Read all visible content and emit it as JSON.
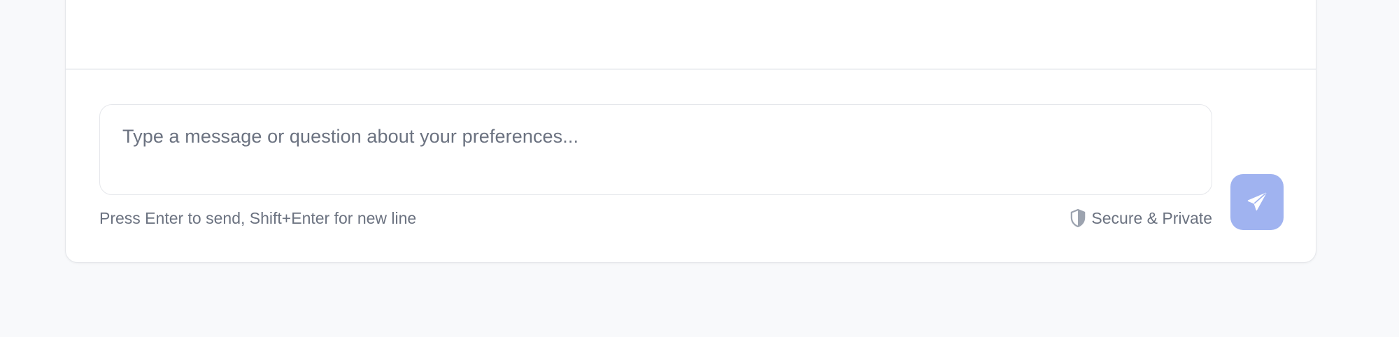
{
  "composer": {
    "placeholder": "Type a message or question about your preferences...",
    "value": "",
    "hint": "Press Enter to send, Shift+Enter for new line",
    "secure_label": "Secure & Private",
    "send_icon": "paper-plane-icon",
    "shield_icon": "shield-icon"
  },
  "colors": {
    "page_background": "#f8f9fb",
    "card_background": "#ffffff",
    "border": "#e5e7eb",
    "muted_text": "#6b7280",
    "send_button": "#a0b3f0",
    "send_icon": "#ffffff"
  }
}
